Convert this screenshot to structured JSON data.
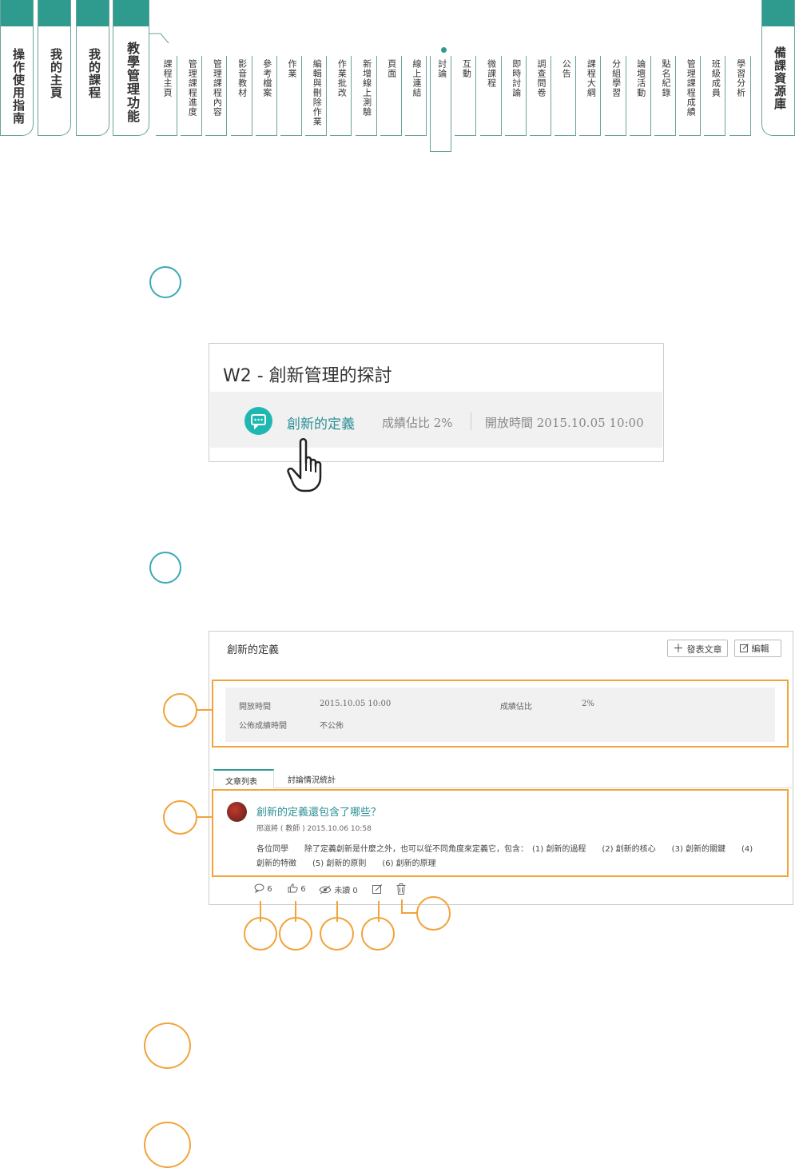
{
  "nav": {
    "big_tabs": [
      {
        "label": "操作使用指南"
      },
      {
        "label": "我的主頁"
      },
      {
        "label": "我的課程"
      },
      {
        "label": "教學管理功能"
      }
    ],
    "small_tabs": [
      "課程主頁",
      "管理課程進度",
      "管理課程內容",
      "影音教材",
      "參考檔案",
      "作業",
      "編輯與刪除作業",
      "作業批改",
      "新增線上測驗",
      "頁面",
      "線上連結",
      "討論",
      "互動",
      "微課程",
      "即時討論",
      "調查問卷",
      "公告",
      "課程大綱",
      "分組學習",
      "論壇活動",
      "點名紀錄",
      "管理課程成績",
      "班級成員",
      "學習分析"
    ],
    "active_tab": "討論",
    "right_tab": "備課資源庫"
  },
  "card1": {
    "title": "W2 - 創新管理的探討",
    "link": "創新的定義",
    "weight": "成績佔比 2%",
    "open_time": "開放時間 2015.10.05 10:00"
  },
  "card2": {
    "title": "創新的定義",
    "post_button": "發表文章",
    "edit_button": "編輯",
    "info": {
      "open_label": "開放時間",
      "open_value": "2015.10.05 10:00",
      "weight_label": "成績佔比",
      "weight_value": "2%",
      "publish_label": "公佈成績時間",
      "publish_value": "不公佈"
    },
    "tabs": [
      "文章列表",
      "討論情況統計"
    ],
    "post": {
      "title": "創新的定義還包含了哪些？",
      "meta": "邢滋將 ( 教師 ) 2015.10.06 10:58",
      "body": "各位同學　　除了定義創新是什麼之外，也可以從不同角度來定義它，包含：　(1) 創新的過程　　(2) 創新的核心　　(3) 創新的關鍵　　(4) 創新的特徵　　(5) 創新的原則　　(6) 創新的原理"
    },
    "stats": {
      "comments": "6",
      "likes": "6",
      "unread": "未讀 0"
    }
  },
  "icons": [
    "chat-bubble-icon",
    "hand-pointer-icon",
    "plus-icon",
    "edit-icon",
    "comment-icon",
    "thumbs-up-icon",
    "eye-icon",
    "pencil-icon",
    "trash-icon"
  ],
  "colors": {
    "teal": "#2f9a8e",
    "teal_accent": "#1fb8b0",
    "orange": "#f2a33a",
    "link": "#2b8f95"
  }
}
